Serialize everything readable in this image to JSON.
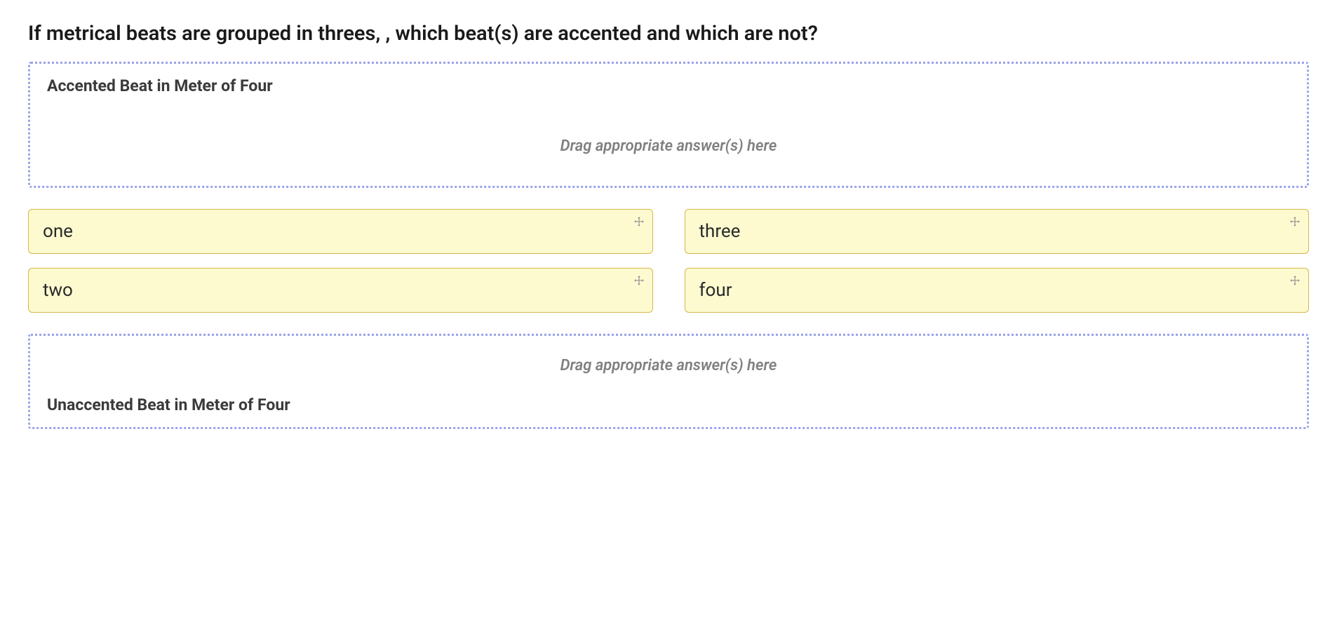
{
  "question": {
    "prompt": "If metrical beats are grouped in threes, , which beat(s) are accented and which are not?"
  },
  "drop_zones": {
    "top": {
      "title": "Accented Beat in Meter of Four",
      "hint": "Drag appropriate answer(s) here"
    },
    "bottom": {
      "title": "Unaccented Beat in Meter of Four",
      "hint": "Drag appropriate answer(s) here"
    }
  },
  "answers": {
    "option_1": "one",
    "option_2": "two",
    "option_3": "three",
    "option_4": "four"
  }
}
